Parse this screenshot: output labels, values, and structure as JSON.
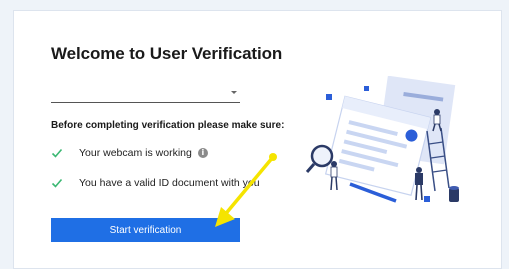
{
  "page": {
    "title": "Welcome to User Verification",
    "select_value": "",
    "subtitle": "Before completing verification please make sure:",
    "requirements": [
      {
        "label": "Your webcam is working",
        "has_info": true
      },
      {
        "label": "You have a valid ID document with you",
        "has_info": false
      }
    ],
    "info_symbol": "i",
    "start_button_label": "Start verification"
  },
  "colors": {
    "accent": "#1f6fe5",
    "check": "#3bb873",
    "annotation": "#f5e400"
  },
  "icons": [
    "chevron-down-icon",
    "checkmark-icon",
    "info-icon",
    "verification-illustration"
  ]
}
